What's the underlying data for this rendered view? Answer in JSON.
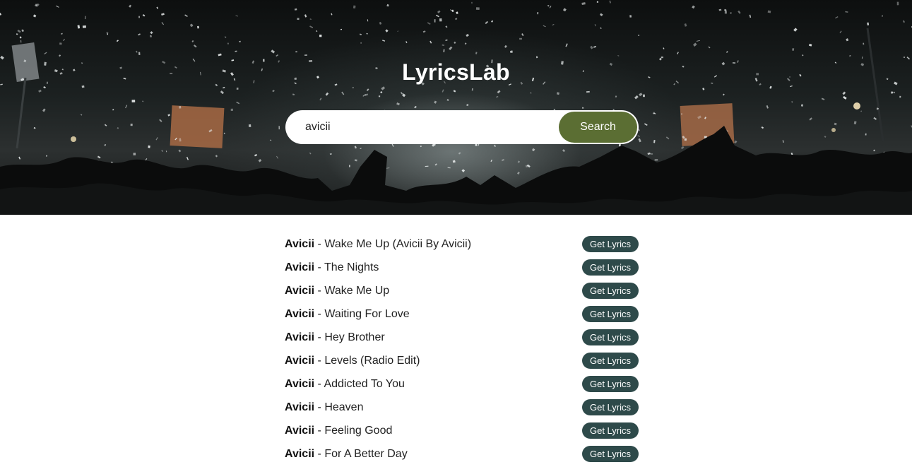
{
  "header": {
    "title": "LyricsLab",
    "background_image": "concert-crowd-confetti"
  },
  "search": {
    "value": "avicii",
    "placeholder": "",
    "button_label": "Search"
  },
  "results": [
    {
      "artist": "Avicii",
      "separator": " - ",
      "title": "Wake Me Up (Avicii By Avicii)",
      "button": "Get Lyrics"
    },
    {
      "artist": "Avicii",
      "separator": " - ",
      "title": "The Nights",
      "button": "Get Lyrics"
    },
    {
      "artist": "Avicii",
      "separator": " - ",
      "title": "Wake Me Up",
      "button": "Get Lyrics"
    },
    {
      "artist": "Avicii",
      "separator": " - ",
      "title": "Waiting For Love",
      "button": "Get Lyrics"
    },
    {
      "artist": "Avicii",
      "separator": " - ",
      "title": "Hey Brother",
      "button": "Get Lyrics"
    },
    {
      "artist": "Avicii",
      "separator": " - ",
      "title": "Levels (Radio Edit)",
      "button": "Get Lyrics"
    },
    {
      "artist": "Avicii",
      "separator": " - ",
      "title": "Addicted To You",
      "button": "Get Lyrics"
    },
    {
      "artist": "Avicii",
      "separator": " - ",
      "title": "Heaven",
      "button": "Get Lyrics"
    },
    {
      "artist": "Avicii",
      "separator": " - ",
      "title": "Feeling Good",
      "button": "Get Lyrics"
    },
    {
      "artist": "Avicii",
      "separator": " - ",
      "title": "For A Better Day",
      "button": "Get Lyrics"
    }
  ],
  "colors": {
    "search_button": "#5b6e33",
    "lyrics_button": "#2e4a4a",
    "page_background": "#ffffff"
  }
}
